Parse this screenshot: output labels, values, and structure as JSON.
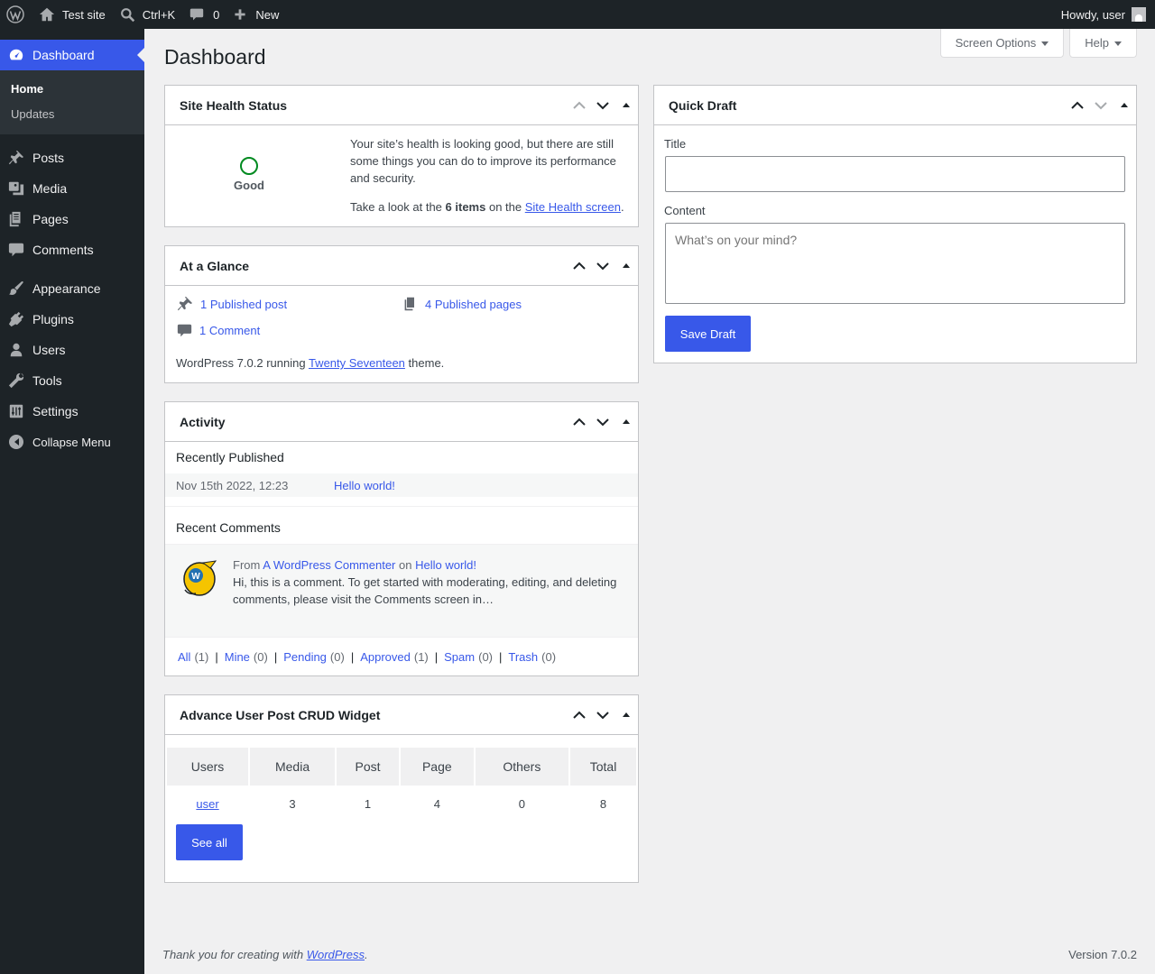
{
  "admin_bar": {
    "site_name": "Test site",
    "search_shortcut": "Ctrl+K",
    "comments_count": "0",
    "new_label": "New",
    "greeting": "Howdy, user"
  },
  "sidebar": {
    "dashboard_label": "Dashboard",
    "submenu": [
      {
        "label": "Home"
      },
      {
        "label": "Updates"
      }
    ],
    "items": [
      {
        "label": "Posts"
      },
      {
        "label": "Media"
      },
      {
        "label": "Pages"
      },
      {
        "label": "Comments"
      },
      {
        "label": "Appearance"
      },
      {
        "label": "Plugins"
      },
      {
        "label": "Users"
      },
      {
        "label": "Tools"
      },
      {
        "label": "Settings"
      }
    ],
    "collapse_label": "Collapse Menu"
  },
  "screen_options_label": "Screen Options",
  "help_label": "Help",
  "page_title": "Dashboard",
  "site_health": {
    "title": "Site Health Status",
    "status": "Good",
    "message": "Your site’s health is looking good, but there are still some things you can do to improve its performance and security.",
    "items_prefix": "Take a look at the",
    "items_count": "6 items",
    "items_mid": "on the",
    "link": "Site Health screen",
    "items_suffix": "."
  },
  "at_a_glance": {
    "title": "At a Glance",
    "posts": "1 Published post",
    "pages": "4 Published pages",
    "comments": "1 Comment",
    "version_prefix": "WordPress 7.0.2 running",
    "theme": "Twenty Seventeen",
    "version_suffix": "theme."
  },
  "activity": {
    "title": "Activity",
    "recently_published_heading": "Recently Published",
    "published": [
      {
        "date": "Nov 15th 2022, 12:23",
        "title": "Hello world!"
      }
    ],
    "recent_comments_heading": "Recent Comments",
    "comment": {
      "from": "From",
      "author": "A WordPress Commenter",
      "on": "on",
      "post": "Hello world!",
      "excerpt": "Hi, this is a comment. To get started with moderating, editing, and deleting comments, please visit the Comments screen in…"
    },
    "filters": [
      {
        "label": "All",
        "count": "(1)"
      },
      {
        "label": "Mine",
        "count": "(0)"
      },
      {
        "label": "Pending",
        "count": "(0)"
      },
      {
        "label": "Approved",
        "count": "(1)"
      },
      {
        "label": "Spam",
        "count": "(0)"
      },
      {
        "label": "Trash",
        "count": "(0)"
      }
    ],
    "separator": "|"
  },
  "crud_widget": {
    "title": "Advance User Post CRUD Widget",
    "columns": [
      "Users",
      "Media",
      "Post",
      "Page",
      "Others",
      "Total"
    ],
    "rows": [
      [
        "user",
        "3",
        "1",
        "4",
        "0",
        "8"
      ]
    ],
    "button": "See all"
  },
  "quick_draft": {
    "title": "Quick Draft",
    "title_label": "Title",
    "title_value": "",
    "content_label": "Content",
    "content_placeholder": "What’s on your mind?",
    "save_button": "Save Draft"
  },
  "footer": {
    "thanks_prefix": "Thank you for creating with",
    "link": "WordPress",
    "thanks_suffix": ".",
    "version": "Version 7.0.2"
  }
}
